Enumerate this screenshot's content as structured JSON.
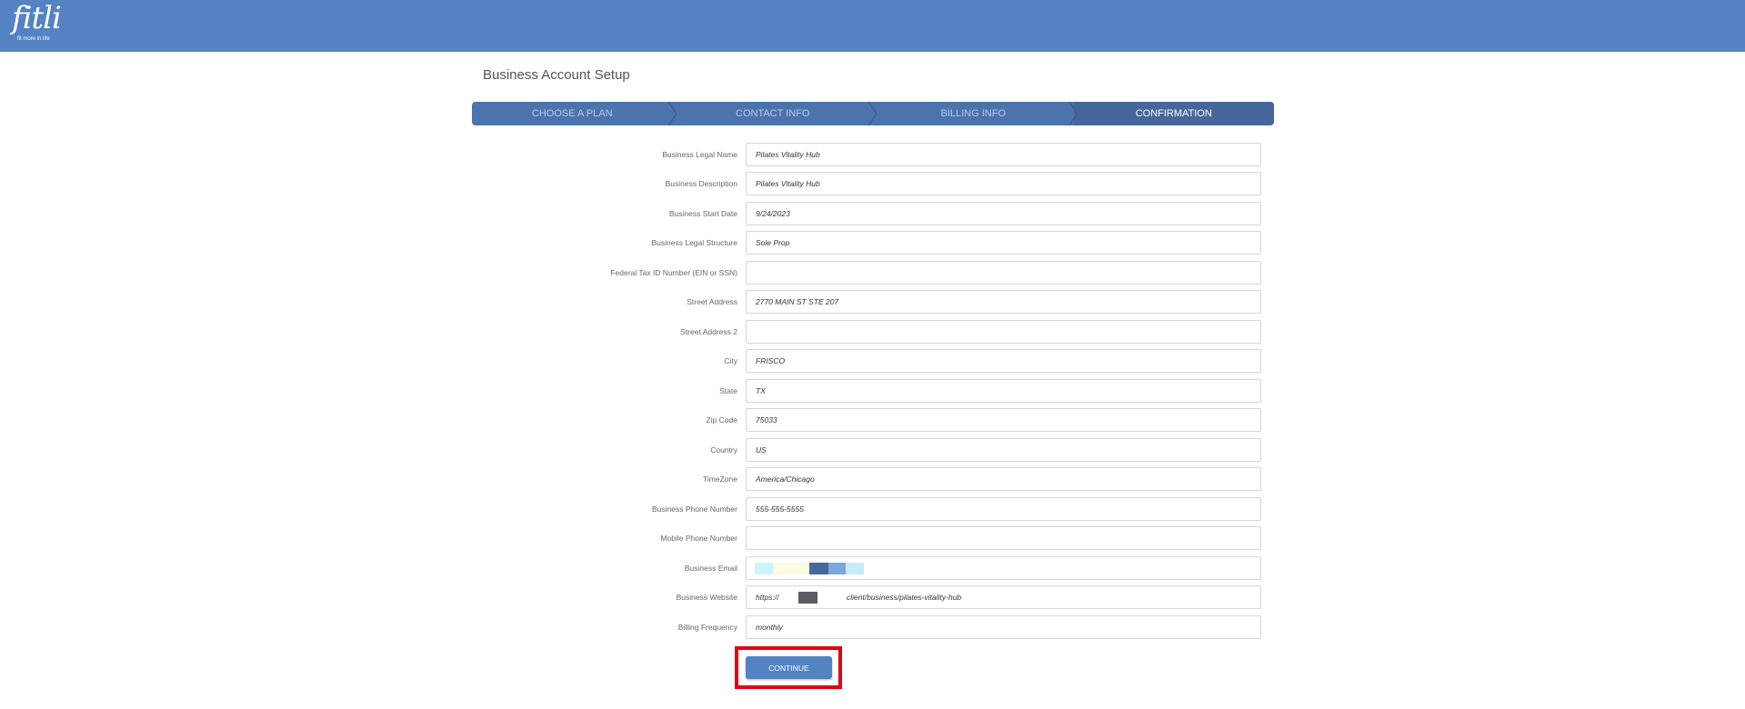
{
  "header": {
    "logo_text": "fitli",
    "logo_tagline": "fit more in life"
  },
  "page": {
    "title": "Business Account Setup"
  },
  "steps": [
    {
      "label": "CHOOSE A PLAN",
      "active": false
    },
    {
      "label": "CONTACT INFO",
      "active": false
    },
    {
      "label": "BILLING INFO",
      "active": false
    },
    {
      "label": "CONFIRMATION",
      "active": true
    }
  ],
  "form": {
    "fields": [
      {
        "label": "Business Legal Name",
        "value": "Pilates Vitality Hub"
      },
      {
        "label": "Business Description",
        "value": "Pilates Vitality Hub"
      },
      {
        "label": "Business Start Date",
        "value": "9/24/2023"
      },
      {
        "label": "Business Legal Structure",
        "value": "Sole Prop"
      },
      {
        "label": "Federal Tax ID Number (EIN or SSN)",
        "value": ""
      },
      {
        "label": "Street Address",
        "value": "2770 MAIN ST STE 207"
      },
      {
        "label": "Street Address 2",
        "value": ""
      },
      {
        "label": "City",
        "value": "FRISCO"
      },
      {
        "label": "State",
        "value": "TX"
      },
      {
        "label": "Zip Code",
        "value": "75033"
      },
      {
        "label": "Country",
        "value": "US"
      },
      {
        "label": "TimeZone",
        "value": "America/Chicago"
      },
      {
        "label": "Business Phone Number",
        "value": "555-555-5555"
      },
      {
        "label": "Mobile Phone Number",
        "value": ""
      },
      {
        "label": "Business Email",
        "value": ""
      },
      {
        "label": "Business Website",
        "value_prefix": "https://",
        "value_suffix": "client/business/pilates-vitality-hub"
      },
      {
        "label": "Billing Frequency",
        "value": "monthly"
      }
    ]
  },
  "continue_label": "CONTINUE",
  "colors": {
    "header": "#5383c3",
    "stepper": "#4b73ad",
    "stepper_active": "#45679c",
    "highlight_border": "#e3000f"
  }
}
